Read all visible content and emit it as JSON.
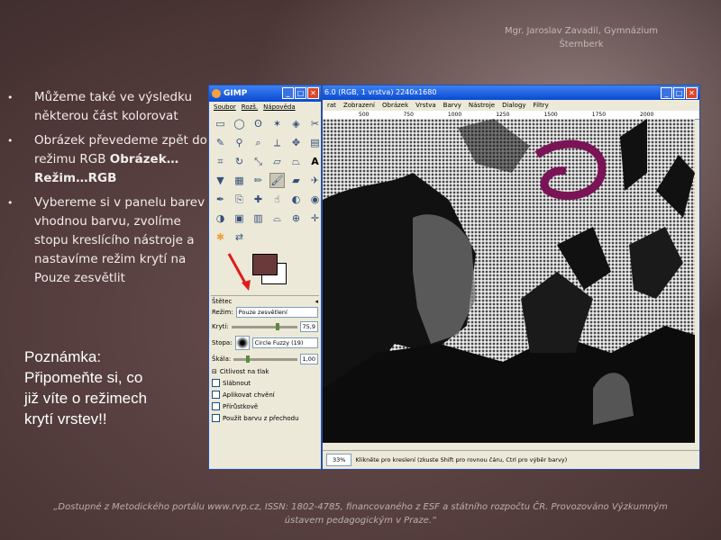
{
  "author": [
    "Mgr. Jaroslav Zavadil, Gymnázium",
    "Šternberk"
  ],
  "bullets": [
    {
      "bullet": "•",
      "text": "Můžeme také ve výsledku některou část kolorovat"
    },
    {
      "bullet": "•",
      "text_pre": "Obrázek převedeme zpět do režimu RGB ",
      "text_bold": "Obrázek…Režim…RGB"
    },
    {
      "bullet": "•",
      "text": "Vybereme si v panelu barev vhodnou barvu, zvolíme stopu kreslícího nástroje a nastavíme režim krytí na Pouze zesvětlit"
    }
  ],
  "note": [
    "Poznámka:",
    "Připomeňte si, co",
    "již víte o režimech",
    "krytí vrstev!!"
  ],
  "footer": [
    "„Dostupné z Metodického portálu www.rvp.cz, ISSN: 1802-4785, financovaného z ESF a státního rozpočtu ČR. Provozováno Výzkumným",
    "ústavem pedagogickým v Praze.“"
  ],
  "toolbox": {
    "title": "GIMP",
    "menu": [
      "Soubor",
      "Rozš.",
      "Nápověda"
    ],
    "tool_options_label": "Štětec",
    "mode_label": "Režim:",
    "mode_value": "Pouze zesvětlení",
    "opacity_label": "Krytí:",
    "opacity_value": "75,9",
    "brush_label": "Stopa:",
    "brush_value": "Circle Fuzzy (19)",
    "scale_label": "Škála:",
    "scale_value": "1,00",
    "pressure_label": "Citlivost na tlak",
    "checkboxes": [
      "Slábnout",
      "Aplikovat chvění",
      "Přírůstkově",
      "Použít barvu z přechodu"
    ],
    "fg_color": "#6a3a3a"
  },
  "imgwin": {
    "title": "6.0 (RGB, 1 vrstva) 2240x1680",
    "menu": [
      "rat",
      "Zobrazení",
      "Obrázek",
      "Vrstva",
      "Barvy",
      "Nástroje",
      "Dialogy",
      "Filtry"
    ],
    "ruler": [
      "500",
      "750",
      "1000",
      "1250",
      "1500",
      "1750",
      "2000"
    ],
    "zoom": "33%",
    "status": "Klikněte pro kreslení (zkuste Shift pro rovnou čáru, Ctrl pro výběr barvy)"
  }
}
